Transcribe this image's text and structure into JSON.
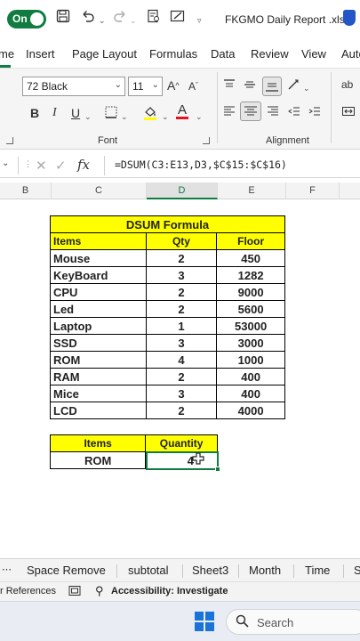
{
  "titlebar": {
    "autosave_state": "On",
    "doc_title": "FKGMO Daily Report .xlsx"
  },
  "menu": {
    "tabs": [
      "me",
      "Insert",
      "Page Layout",
      "Formulas",
      "Data",
      "Review",
      "View",
      "Auto"
    ]
  },
  "ribbon": {
    "font_name": "72 Black",
    "font_size": "11",
    "bold": "B",
    "italic": "I",
    "underline": "U",
    "font_color_letter": "A",
    "grow_font": "A",
    "shrink_font": "A",
    "group_font": "Font",
    "group_alignment": "Alignment",
    "wrap_icon": "ab"
  },
  "formula_bar": {
    "fx": "fx",
    "formula": "=DSUM(C3:E13,D3,$C$15:$C$16)"
  },
  "columns": [
    "B",
    "C",
    "D",
    "E",
    "F"
  ],
  "main_table": {
    "title": "DSUM Formula",
    "headers": [
      "Items",
      "Qty",
      "Floor"
    ],
    "rows": [
      [
        "Mouse",
        "2",
        "450"
      ],
      [
        "KeyBoard",
        "3",
        "1282"
      ],
      [
        "CPU",
        "2",
        "9000"
      ],
      [
        "Led",
        "2",
        "5600"
      ],
      [
        "Laptop",
        "1",
        "53000"
      ],
      [
        "SSD",
        "3",
        "3000"
      ],
      [
        "ROM",
        "4",
        "1000"
      ],
      [
        "RAM",
        "2",
        "400"
      ],
      [
        "Mice",
        "3",
        "400"
      ],
      [
        "LCD",
        "2",
        "4000"
      ]
    ]
  },
  "lookup_table": {
    "headers": [
      "Items",
      "Quantity"
    ],
    "row": [
      "ROM",
      "4"
    ]
  },
  "sheet_tabs": [
    "Space Remove",
    "subtotal",
    "Sheet3",
    "Month",
    "Time",
    "S"
  ],
  "status": {
    "references": "r References",
    "accessibility": "Accessibility: Investigate"
  },
  "taskbar": {
    "search_label": "Search"
  },
  "colors": {
    "excel_green": "#107c41",
    "header_yellow": "#ffff00",
    "font_color_red": "#e81123",
    "highlight_yellow": "#ffff00"
  }
}
